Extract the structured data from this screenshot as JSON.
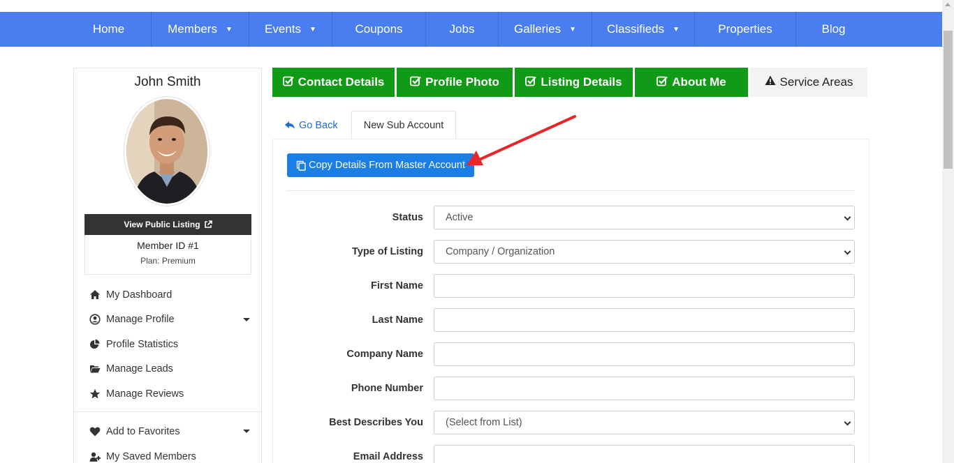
{
  "nav": {
    "items": [
      {
        "label": "Home",
        "dropdown": false
      },
      {
        "label": "Members",
        "dropdown": true
      },
      {
        "label": "Events",
        "dropdown": true
      },
      {
        "label": "Coupons",
        "dropdown": false
      },
      {
        "label": "Jobs",
        "dropdown": false
      },
      {
        "label": "Galleries",
        "dropdown": true
      },
      {
        "label": "Classifieds",
        "dropdown": true
      },
      {
        "label": "Properties",
        "dropdown": false
      },
      {
        "label": "Blog",
        "dropdown": false
      }
    ],
    "caret": "▼"
  },
  "profile": {
    "name": "John Smith",
    "view_listing_label": "View Public Listing",
    "member_id": "Member ID #1",
    "plan": "Plan: Premium"
  },
  "sidebar": {
    "menu": [
      {
        "label": "My Dashboard",
        "icon": "home-icon",
        "dropdown": false
      },
      {
        "label": "Manage Profile",
        "icon": "user-circle-icon",
        "dropdown": true
      },
      {
        "label": "Profile Statistics",
        "icon": "pie-chart-icon",
        "dropdown": false
      },
      {
        "label": "Manage Leads",
        "icon": "folder-open-icon",
        "dropdown": false
      },
      {
        "label": "Manage Reviews",
        "icon": "star-icon",
        "dropdown": false
      }
    ],
    "menu2": [
      {
        "label": "Add to Favorites",
        "icon": "heart-icon",
        "dropdown": true
      },
      {
        "label": "My Saved Members",
        "icon": "user-plus-icon",
        "dropdown": false
      }
    ]
  },
  "steps": [
    {
      "label": "Contact Details",
      "icon": "check-square-icon",
      "done": true
    },
    {
      "label": "Profile Photo",
      "icon": "check-square-icon",
      "done": true
    },
    {
      "label": "Listing Details",
      "icon": "check-square-icon",
      "done": true
    },
    {
      "label": "About Me",
      "icon": "check-square-icon",
      "done": true
    },
    {
      "label": "Service Areas",
      "icon": "warning-icon",
      "done": false
    }
  ],
  "tabs": {
    "go_back": "Go Back",
    "new_sub_account": "New Sub Account"
  },
  "copy_button": "Copy Details From Master Account",
  "form": {
    "status": {
      "label": "Status",
      "value": "Active"
    },
    "type_of_listing": {
      "label": "Type of Listing",
      "value": "Company / Organization"
    },
    "first_name": {
      "label": "First Name",
      "value": ""
    },
    "last_name": {
      "label": "Last Name",
      "value": ""
    },
    "company_name": {
      "label": "Company Name",
      "value": ""
    },
    "phone_number": {
      "label": "Phone Number",
      "value": ""
    },
    "best_describes": {
      "label": "Best Describes You",
      "value": "(Select from List)"
    },
    "email_address": {
      "label": "Email Address",
      "value": ""
    }
  },
  "colors": {
    "nav_bg": "#4a7df0",
    "step_done": "#119a16",
    "copy_button": "#1a7ee6",
    "annotation_arrow": "#e8262b"
  }
}
